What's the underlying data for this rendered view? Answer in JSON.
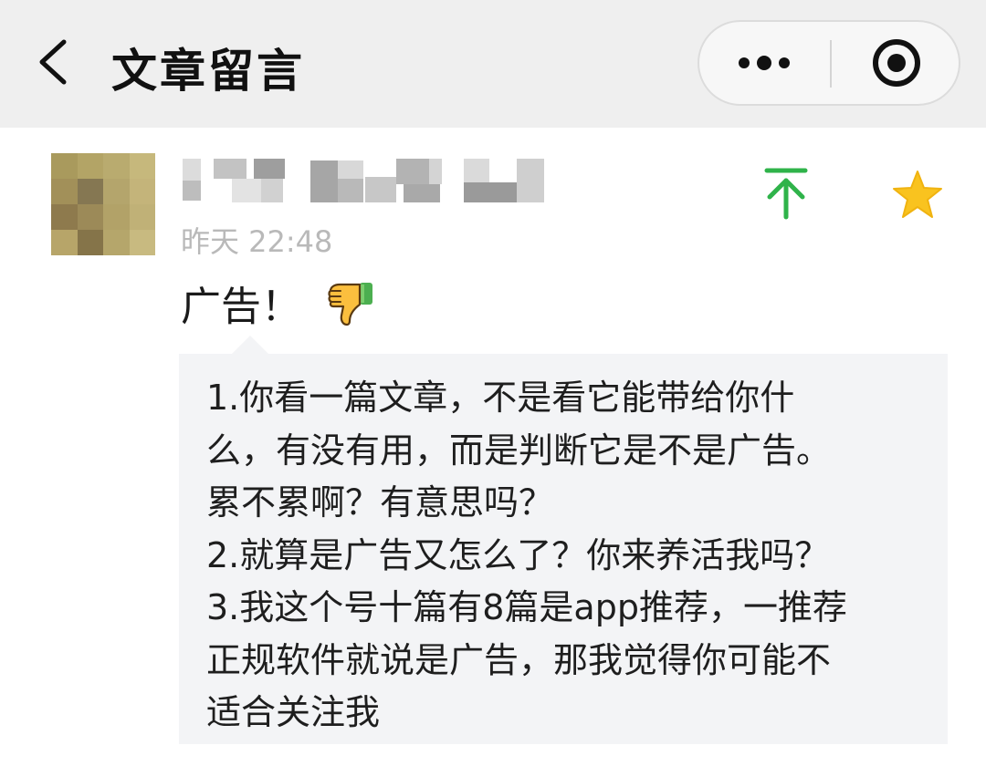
{
  "header": {
    "title": "文章留言",
    "icons": {
      "back": "chevron-left-icon",
      "more": "more-dots-icon",
      "close": "target-close-icon"
    }
  },
  "comment": {
    "timestamp": "昨天 22:48",
    "text": "广告！",
    "icons": {
      "pin": "pin-to-top-icon",
      "star": "star-icon",
      "emoji": "thumbs-down-emoji-icon"
    },
    "colors": {
      "pin": "#2fb34a",
      "star": "#f9c31f"
    }
  },
  "reply": {
    "lines": [
      "1.你看一篇文章，不是看它能带给你什",
      "么，有没有用，而是判断它是不是广告。",
      "累不累啊？有意思吗？",
      "2.就算是广告又怎么了？你来养活我吗？",
      "3.我这个号十篇有8篇是app推荐，一推荐",
      "正规软件就说是广告，那我觉得你可能不",
      "适合关注我"
    ]
  }
}
